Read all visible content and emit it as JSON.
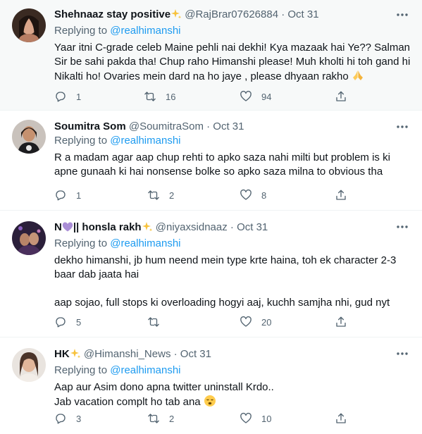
{
  "replying_prefix": "Replying to",
  "tweets": [
    {
      "name": "Shehnaaz stay positive",
      "handle": "@RajBrar07626884",
      "sep": "·",
      "date": "Oct 31",
      "replying_to": "@realhimanshi",
      "lines": [
        "Yaar itni C-grade celeb Maine pehli nai dekhi! Kya mazaak hai Ye?? Salman",
        "Sir be sahi pakda tha! Chup raho Himanshi please! Muh kholti hi toh gand hi",
        "Nikalti ho! Ovaries mein dard na ho jaye , please dhyaan rakho"
      ],
      "replies": "1",
      "retweets": "16",
      "likes": "94"
    },
    {
      "name": "Soumitra Som",
      "handle": "@SoumitraSom",
      "sep": "·",
      "date": "Oct 31",
      "replying_to": "@realhimanshi",
      "lines": [
        "R a madam agar aap chup rehti to apko saza nahi milti but problem is ki",
        "apne gunaah ki hai nonsense bolke so apko saza milna to obvious tha"
      ],
      "replies": "1",
      "retweets": "2",
      "likes": "8"
    },
    {
      "name_prefix": "N",
      "name_suffix": "|| honsla rakh",
      "handle": "@niyaxsidnaaz",
      "sep": "·",
      "date": "Oct 31",
      "replying_to": "@realhimanshi",
      "lines": [
        "dekho himanshi, jb hum neend mein type krte haina, toh ek character 2-3",
        "baar dab jaata hai",
        "aap sojao, full stops ki overloading hogyi aaj, kuchh samjha nhi, gud nyt"
      ],
      "replies": "5",
      "retweets": "",
      "likes": "20"
    },
    {
      "name": "HK",
      "handle": "@Himanshi_News",
      "sep": "·",
      "date": "Oct 31",
      "replying_to": "@realhimanshi",
      "lines": [
        "Aap aur Asim dono apna twitter uninstall Krdo..",
        "Jab vacation complt ho tab ana"
      ],
      "replies": "3",
      "retweets": "2",
      "likes": "10"
    }
  ],
  "icons": {
    "more": "more-horizontal-icon",
    "reply": "reply-icon",
    "retweet": "retweet-icon",
    "like": "heart-icon",
    "sparkle": "sparkles-emoji",
    "pray": "folded-hands-emoji",
    "heart": "purple-heart-emoji",
    "face": "sleepy-face-emoji"
  },
  "colors": {
    "link": "#1d9bf0",
    "muted": "#536471",
    "text": "#0f1419",
    "highlight_bg": "#f7f9f9",
    "divider": "#eff3f4"
  }
}
